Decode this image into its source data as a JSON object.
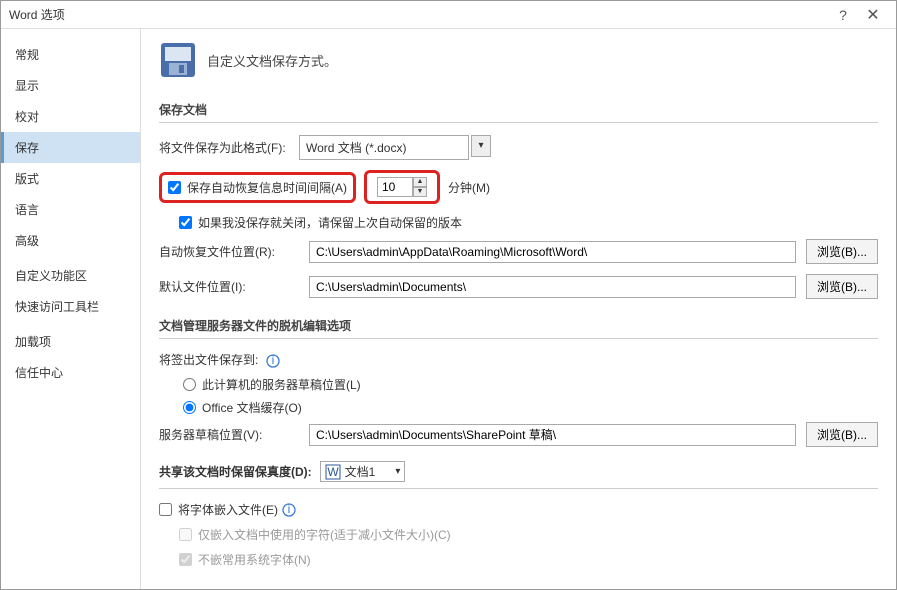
{
  "window": {
    "title": "Word 选项"
  },
  "sidebar": {
    "items": [
      {
        "label": "常规"
      },
      {
        "label": "显示"
      },
      {
        "label": "校对"
      },
      {
        "label": "保存"
      },
      {
        "label": "版式"
      },
      {
        "label": "语言"
      },
      {
        "label": "高级"
      },
      {
        "label": "自定义功能区"
      },
      {
        "label": "快速访问工具栏"
      },
      {
        "label": "加载项"
      },
      {
        "label": "信任中心"
      }
    ],
    "selected_index": 3
  },
  "header": {
    "headline": "自定义文档保存方式。"
  },
  "section_save": {
    "title": "保存文档",
    "format_label": "将文件保存为此格式(F):",
    "format_value": "Word 文档 (*.docx)",
    "autosave_label": "保存自动恢复信息时间间隔(A)",
    "autosave_minutes": "10",
    "minutes_suffix": "分钟(M)",
    "keep_last_label": "如果我没保存就关闭，请保留上次自动保留的版本",
    "autorecover_loc_label": "自动恢复文件位置(R):",
    "autorecover_loc_value": "C:\\Users\\admin\\AppData\\Roaming\\Microsoft\\Word\\",
    "default_loc_label": "默认文件位置(I):",
    "default_loc_value": "C:\\Users\\admin\\Documents\\",
    "browse_label": "浏览(B)..."
  },
  "section_offline": {
    "title": "文档管理服务器文件的脱机编辑选项",
    "save_checkout_label": "将签出文件保存到:",
    "radio_server": "此计算机的服务器草稿位置(L)",
    "radio_cache": "Office 文档缓存(O)",
    "server_draft_label": "服务器草稿位置(V):",
    "server_draft_value": "C:\\Users\\admin\\Documents\\SharePoint 草稿\\",
    "browse_label": "浏览(B)..."
  },
  "section_share": {
    "title": "共享该文档时保留保真度(D):",
    "doc_name": "文档1",
    "embed_fonts": "将字体嵌入文件(E)",
    "embed_used_only": "仅嵌入文档中使用的字符(适于减小文件大小)(C)",
    "no_common_fonts": "不嵌常用系统字体(N)"
  }
}
